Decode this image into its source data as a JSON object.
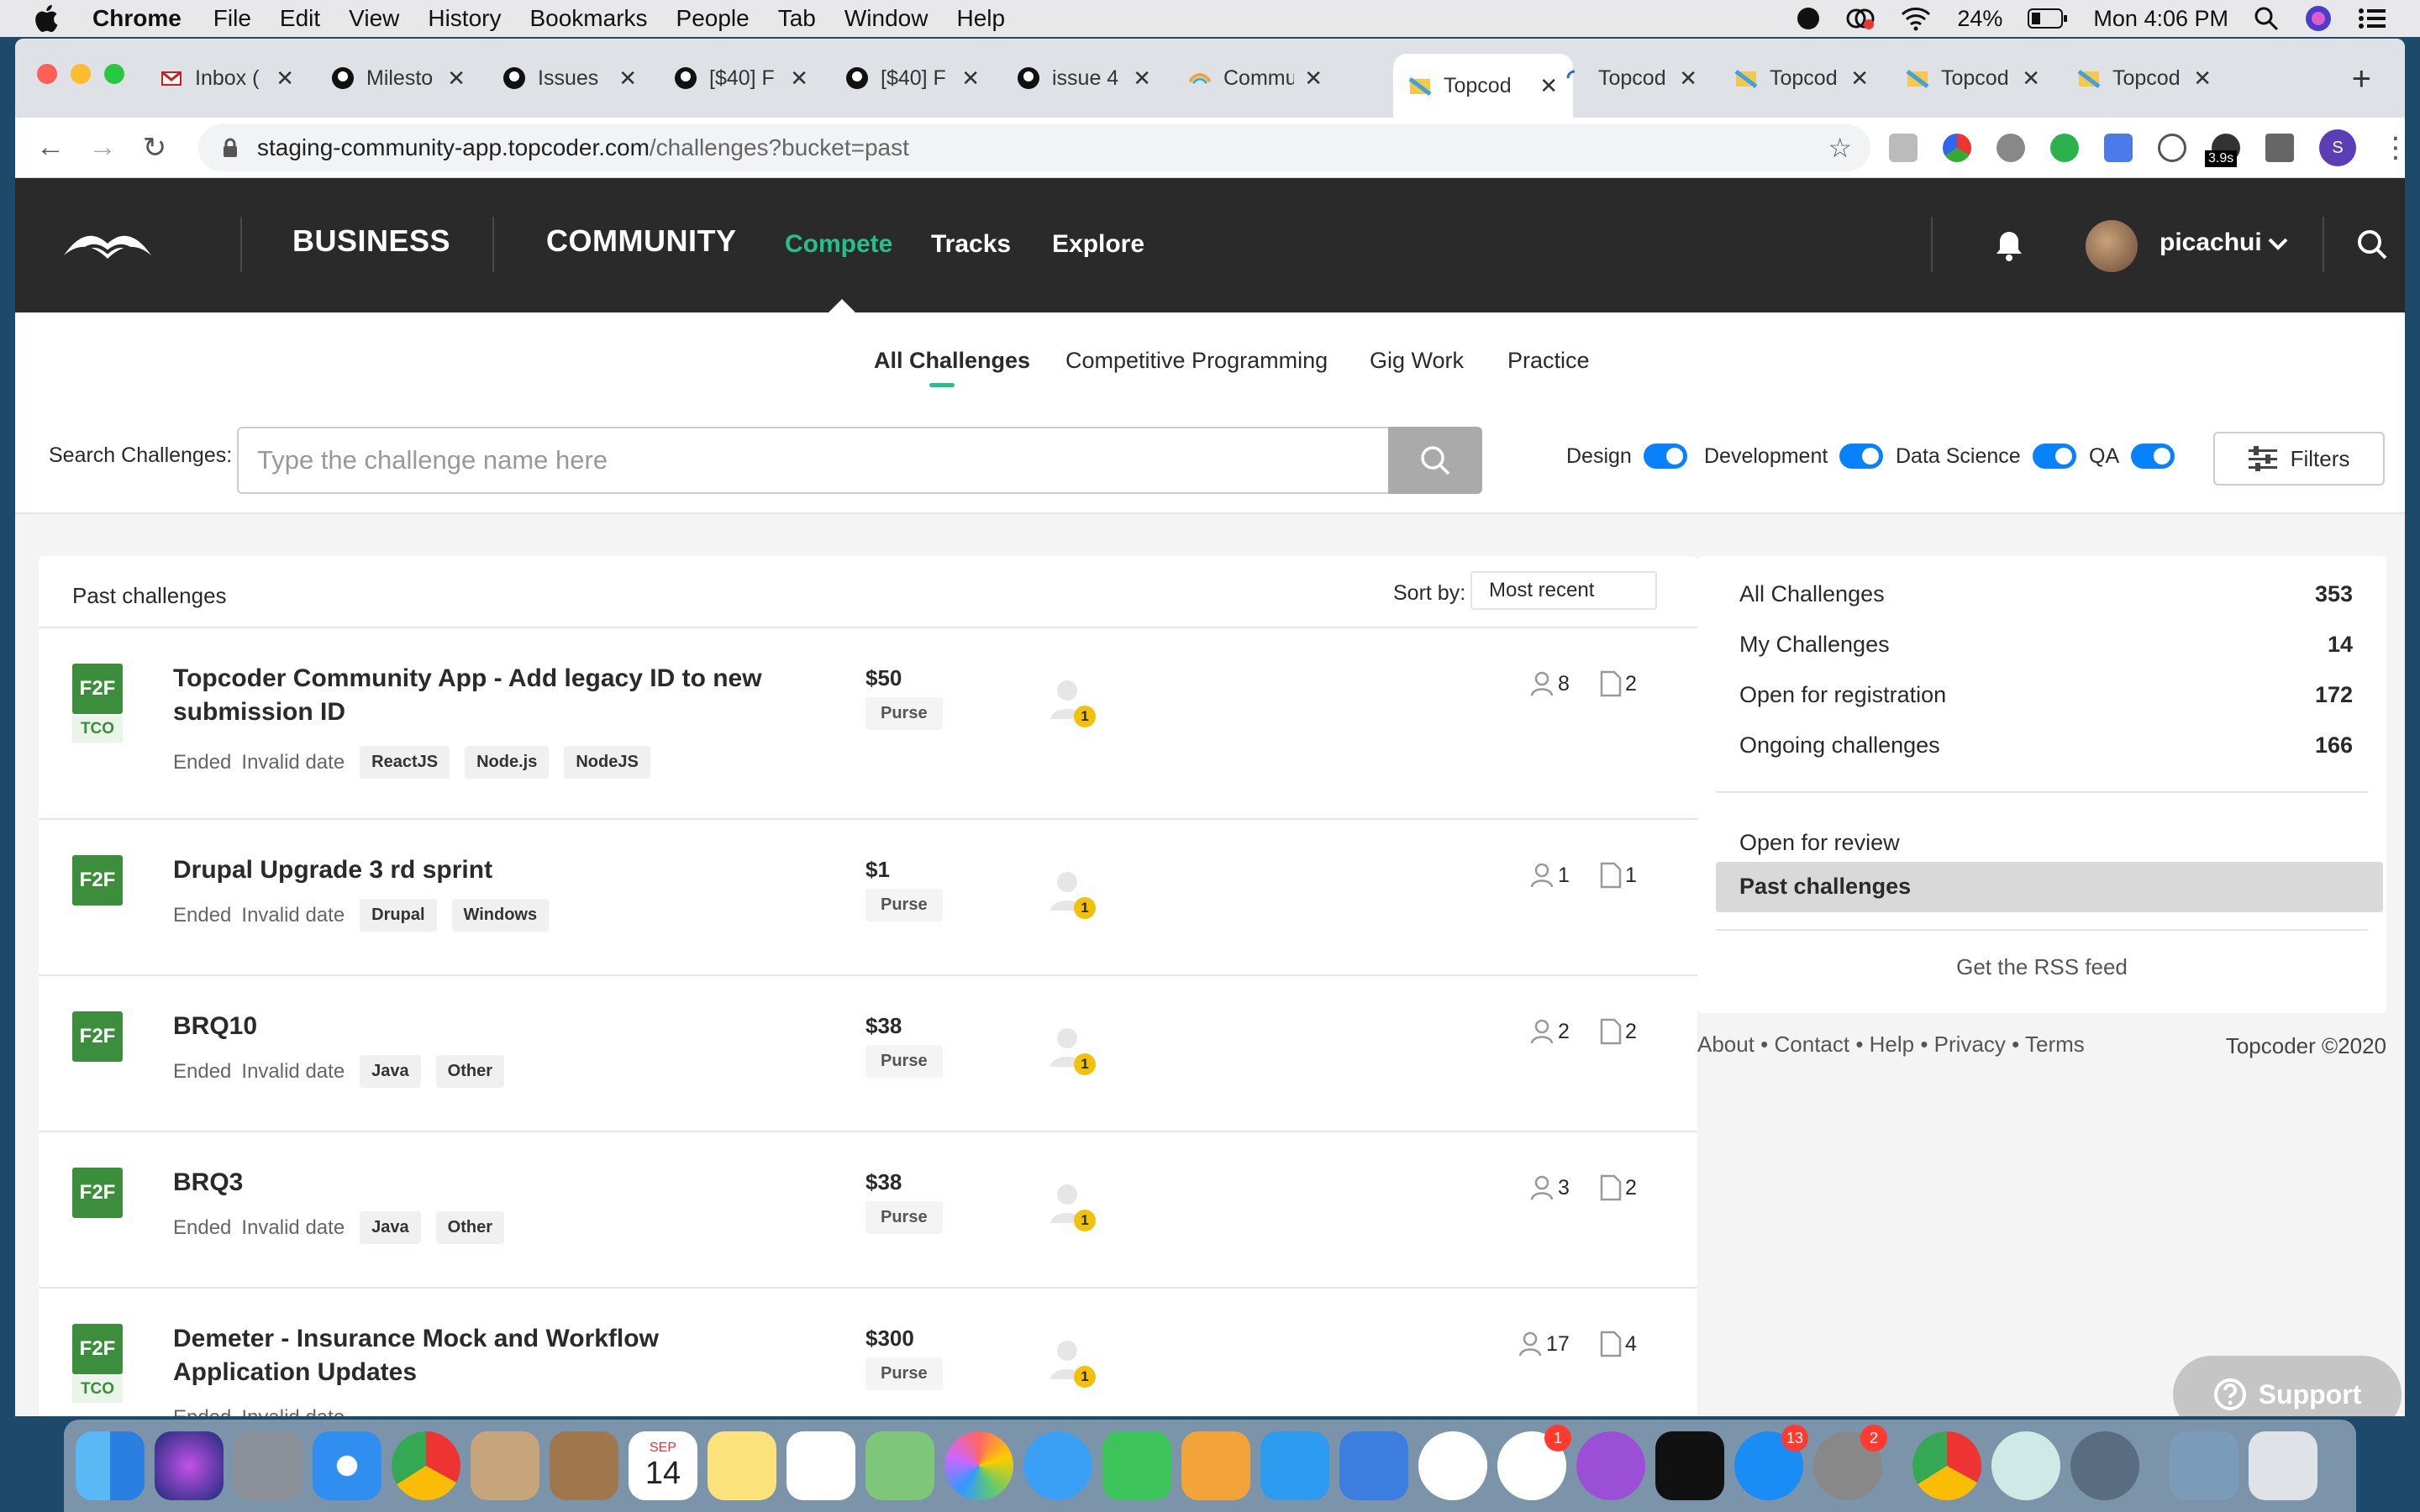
{
  "menubar": {
    "app": "Chrome",
    "items": [
      "File",
      "Edit",
      "View",
      "History",
      "Bookmarks",
      "People",
      "Tab",
      "Window",
      "Help"
    ],
    "battery": "24%",
    "clock": "Mon 4:06 PM"
  },
  "tabs": [
    {
      "title": "Inbox (",
      "icon": "gmail-icon"
    },
    {
      "title": "Milesto",
      "icon": "github-icon"
    },
    {
      "title": "Issues",
      "icon": "github-icon"
    },
    {
      "title": "[$40] F",
      "icon": "github-icon"
    },
    {
      "title": "[$40] F",
      "icon": "github-icon"
    },
    {
      "title": "issue 4",
      "icon": "github-icon"
    },
    {
      "title": "Commu",
      "icon": "community-icon"
    },
    {
      "title": "Topcod",
      "icon": "topcoder-icon"
    },
    {
      "title": "Topcod",
      "icon": "loading-icon"
    },
    {
      "title": "Topcod",
      "icon": "topcoder-icon"
    },
    {
      "title": "Topcod",
      "icon": "topcoder-icon"
    },
    {
      "title": "Topcod",
      "icon": "topcoder-icon"
    }
  ],
  "address": {
    "host": "staging-community-app.topcoder.com",
    "path": "/challenges?bucket=past"
  },
  "extensions": {
    "timer_badge": "3.9s",
    "profile_initial": "S"
  },
  "nav": {
    "business": "BUSINESS",
    "community": "COMMUNITY",
    "compete": "Compete",
    "tracks": "Tracks",
    "explore": "Explore",
    "username": "picachui"
  },
  "subnav": {
    "all": "All Challenges",
    "cp": "Competitive Programming",
    "gig": "Gig Work",
    "practice": "Practice"
  },
  "search": {
    "label": "Search Challenges:",
    "placeholder": "Type the challenge name here"
  },
  "toggles": {
    "design": "Design",
    "development": "Development",
    "data_science": "Data Science",
    "qa": "QA"
  },
  "filters_label": "Filters",
  "list": {
    "heading": "Past challenges",
    "sort_label": "Sort by:",
    "sort_value": "Most recent",
    "purse_label": "Purse",
    "status_prefix": "Ended",
    "status_date": "Invalid date",
    "challenges": [
      {
        "type": "F2F",
        "tco": "TCO",
        "title": "Topcoder Community App - Add legacy ID to new submission ID",
        "tags": [
          "ReactJS",
          "Node.js",
          "NodeJS"
        ],
        "prize": "$50",
        "badge": "1",
        "registrants": "8",
        "submissions": "2"
      },
      {
        "type": "F2F",
        "title": "Drupal Upgrade 3 rd sprint",
        "tags": [
          "Drupal",
          "Windows"
        ],
        "prize": "$1",
        "badge": "1",
        "registrants": "1",
        "submissions": "1"
      },
      {
        "type": "F2F",
        "title": "BRQ10",
        "tags": [
          "Java",
          "Other"
        ],
        "prize": "$38",
        "badge": "1",
        "registrants": "2",
        "submissions": "2"
      },
      {
        "type": "F2F",
        "title": "BRQ3",
        "tags": [
          "Java",
          "Other"
        ],
        "prize": "$38",
        "badge": "1",
        "registrants": "3",
        "submissions": "2"
      },
      {
        "type": "F2F",
        "tco": "TCO",
        "title": "Demeter - Insurance Mock and Workflow Application Updates",
        "tags": [],
        "prize": "$300",
        "badge": "1",
        "registrants": "17",
        "submissions": "4"
      }
    ]
  },
  "sidebar": {
    "buckets": [
      {
        "label": "All Challenges",
        "count": "353"
      },
      {
        "label": "My Challenges",
        "count": "14"
      },
      {
        "label": "Open for registration",
        "count": "172"
      },
      {
        "label": "Ongoing challenges",
        "count": "166"
      }
    ],
    "review": "Open for review",
    "past": "Past challenges",
    "rss": "Get the RSS feed"
  },
  "footer": {
    "links": "About • Contact • Help • Privacy • Terms",
    "copyright": "Topcoder ©2020"
  },
  "support": "Support",
  "dock": {
    "calendar_month": "SEP",
    "calendar_day": "14",
    "slack_badge": "1",
    "appstore_badge": "13",
    "prefs_badge": "2"
  },
  "colors": {
    "accent": "#25c089",
    "toggle": "#0681ff",
    "f2f": "#3c8d3c",
    "nav_bg": "#2a2a2a"
  }
}
